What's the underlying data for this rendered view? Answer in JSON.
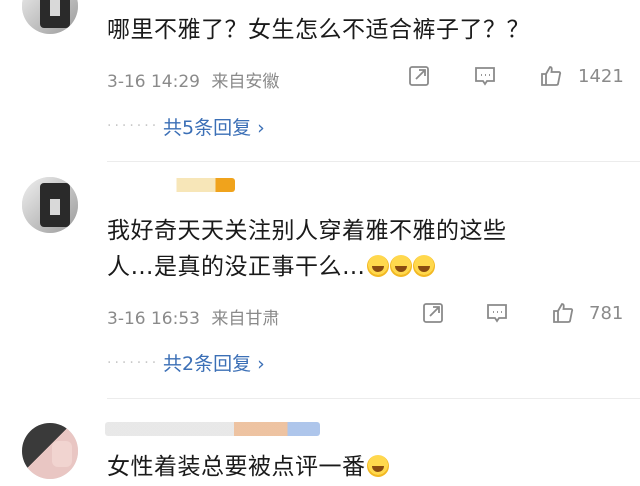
{
  "comments": [
    {
      "text": "哪里不雅了？女生怎么不适合裤子了？？",
      "time": "3-16 14:29",
      "location": "来自安徽",
      "likes": "1421",
      "replies": "共5条回复 ›"
    },
    {
      "text_line1": "我好奇天天关注别人穿着雅不雅的这些",
      "text_line2": "人…是真的没正事干么…",
      "time": "3-16 16:53",
      "location": "来自甘肃",
      "likes": "781",
      "replies": "共2条回复 ›"
    },
    {
      "text": "女性着装总要被点评一番"
    }
  ],
  "colors": {
    "link": "#3b6fb6",
    "meta": "#8a8a8a",
    "username": "#ff8200"
  }
}
